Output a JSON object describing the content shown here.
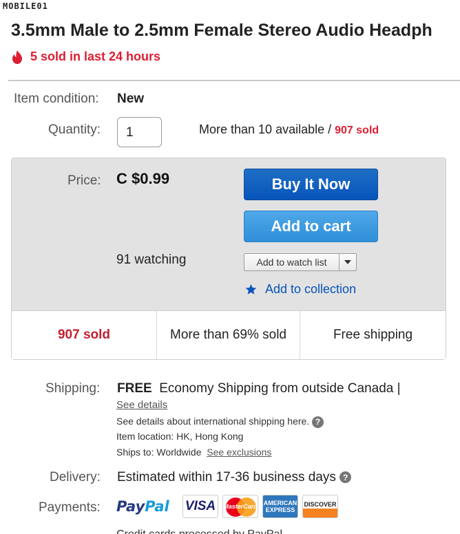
{
  "watermark": {
    "text": "MOBILE01"
  },
  "listing": {
    "title": "3.5mm Male to 2.5mm Female Stereo Audio Headph",
    "urgency": "5 sold in last 24 hours"
  },
  "condition": {
    "label": "Item condition:",
    "value": "New"
  },
  "quantity": {
    "label": "Quantity:",
    "value": "1",
    "available": "More than 10 available / ",
    "sold": "907 sold"
  },
  "price": {
    "label": "Price:",
    "value": "C $0.99",
    "buy_label": "Buy It Now",
    "cart_label": "Add to cart",
    "watching": "91 watching",
    "watch_list_label": "Add to watch list",
    "collection_label": "Add to collection"
  },
  "stats": {
    "sold": "907 sold",
    "percent_sold": "More than 69% sold",
    "shipping": "Free shipping"
  },
  "shipping": {
    "label": "Shipping:",
    "free": "FREE",
    "method": "Economy Shipping from outside Canada |",
    "see_details": "See details",
    "intl_note": "See details about international shipping here.",
    "location_label": "Item location:",
    "location": "HK, Hong Kong",
    "ships_to_label": "Ships to:",
    "ships_to": "Worldwide",
    "exclusions": "See exclusions"
  },
  "delivery": {
    "label": "Delivery:",
    "value": "Estimated within 17-36 business days"
  },
  "payments": {
    "label": "Payments:",
    "paypal_a": "Pay",
    "paypal_b": "Pal",
    "visa": "VISA",
    "mastercard": "MasterCard",
    "amex": "AMERICAN EXPRESS",
    "discover": "DISCOVER"
  },
  "footer_cut": "Credit cards processed by PayPal"
}
